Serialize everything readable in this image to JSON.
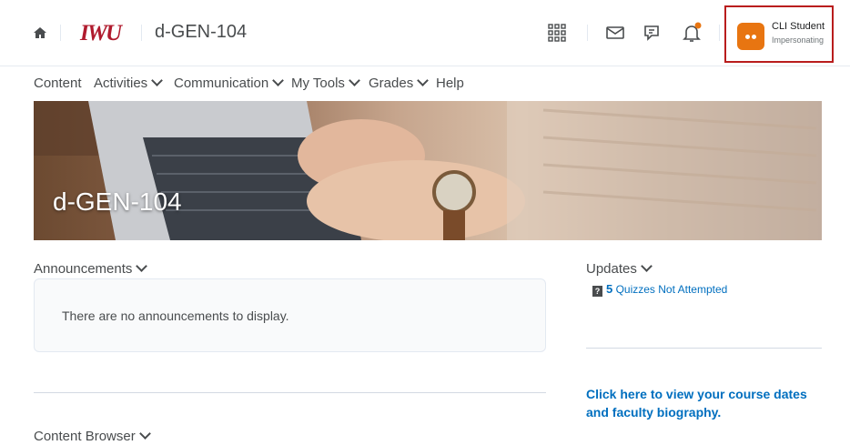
{
  "header": {
    "logo_text": "IWU",
    "course_name": "d-GEN-104",
    "icons": [
      "home-icon",
      "waffle-icon",
      "mail-icon",
      "chat-icon",
      "bell-icon"
    ],
    "user": {
      "name": "CLI Student",
      "status": "Impersonating"
    },
    "accent": "#e87511",
    "highlight_border": "#b91d1d"
  },
  "nav": {
    "items": [
      {
        "label": "Content",
        "has_menu": false
      },
      {
        "label": "Activities",
        "has_menu": true
      },
      {
        "label": "Communication",
        "has_menu": true
      },
      {
        "label": "My Tools",
        "has_menu": true
      },
      {
        "label": "Grades",
        "has_menu": true
      },
      {
        "label": "Help",
        "has_menu": false
      }
    ]
  },
  "banner": {
    "title": "d-GEN-104"
  },
  "announcements": {
    "heading": "Announcements",
    "empty_text": "There are no announcements to display."
  },
  "updates": {
    "heading": "Updates",
    "items": [
      {
        "icon": "quiz-icon",
        "count": "5",
        "label": "Quizzes Not Attempted"
      }
    ]
  },
  "course_link": {
    "text": "Click here to view your course dates and faculty biography."
  },
  "content_browser": {
    "heading": "Content Browser"
  }
}
